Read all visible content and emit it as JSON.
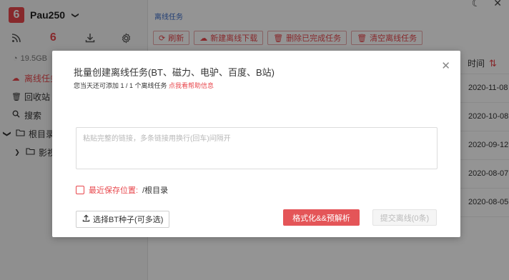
{
  "app": {
    "brand_logo": "6",
    "brand_name": "Pau250",
    "chevron": "❯",
    "toolbar": {
      "rss_icon": "rss-icon",
      "active_label": "6",
      "download_icon": "download-icon",
      "settings_icon": "gear-icon"
    },
    "quota": "19.5GB",
    "nav": [
      {
        "label": "离线任务",
        "icon": "cloud-icon",
        "active": true
      },
      {
        "label": "回收站",
        "icon": "trash-icon"
      },
      {
        "label": "搜索",
        "icon": "search-icon"
      },
      {
        "label": "根目录",
        "icon": "folder-icon",
        "expander": "❯"
      },
      {
        "label": "影视",
        "icon": "folder-icon",
        "expander": "❯"
      }
    ]
  },
  "main": {
    "breadcrumb": "离线任务",
    "actions": [
      {
        "label": "刷新",
        "icon": "refresh-icon"
      },
      {
        "label": "新建离线下载",
        "icon": "cloud-upload-icon"
      },
      {
        "label": "删除已完成任务",
        "icon": "trash-icon"
      },
      {
        "label": "清空离线任务",
        "icon": "trash-icon"
      }
    ],
    "column_time": "时间",
    "dates": [
      "2020-11-08",
      "2020-10-08",
      "2020-09-12",
      "2020-08-07",
      "2020-08-05"
    ]
  },
  "dialog": {
    "title": "批量创建离线任务(BT、磁力、电驴、百度、B站)",
    "subtitle_prefix": "您当天还可添加 1 / 1 个离线任务 ",
    "help_link": "点我看帮助信息",
    "textarea_placeholder": "粘贴完整的链接，多条链接用换行(回车)间隔开",
    "textarea_value": "",
    "save_label": "最近保存位置:",
    "save_path": "/根目录",
    "seed_button": "选择BT种子(可多选)",
    "format_button": "格式化&&预解析",
    "submit_button": "提交离线(0条)"
  },
  "colors": {
    "accent": "#e8474c",
    "link": "#3a6bc8"
  }
}
